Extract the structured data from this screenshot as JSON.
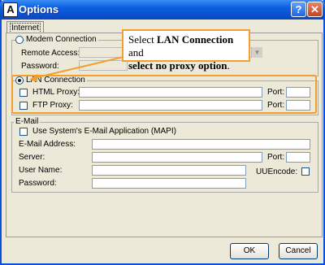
{
  "window": {
    "title": "Options",
    "app_icon": "A",
    "help_glyph": "?",
    "close_glyph": "✕"
  },
  "tabs": [
    {
      "label": "Internet"
    }
  ],
  "modem": {
    "label": "Modem Connection",
    "remote_access_label": "Remote Access:",
    "password_label": "Password:",
    "selected": false
  },
  "lan": {
    "label": "LAN Connection",
    "selected": true,
    "html_proxy_label": "HTML Proxy:",
    "ftp_proxy_label": "FTP Proxy:",
    "port_label": "Port:"
  },
  "email": {
    "group_label": "E-Mail",
    "use_mapi_label": "Use System's E-Mail Application (MAPI)",
    "address_label": "E-Mail Address:",
    "server_label": "Server:",
    "port_label": "Port:",
    "username_label": "User Name:",
    "uuencode_label": "UUEncode:",
    "password_label": "Password:"
  },
  "callout": {
    "prefix": "Select ",
    "bold1": "LAN Connection",
    "middle": " and",
    "bold2": "select no proxy option",
    "suffix": "."
  },
  "buttons": {
    "ok": "OK",
    "cancel": "Cancel"
  },
  "colors": {
    "accent": "#f0a030",
    "titlebar": "#0b5fe0"
  }
}
